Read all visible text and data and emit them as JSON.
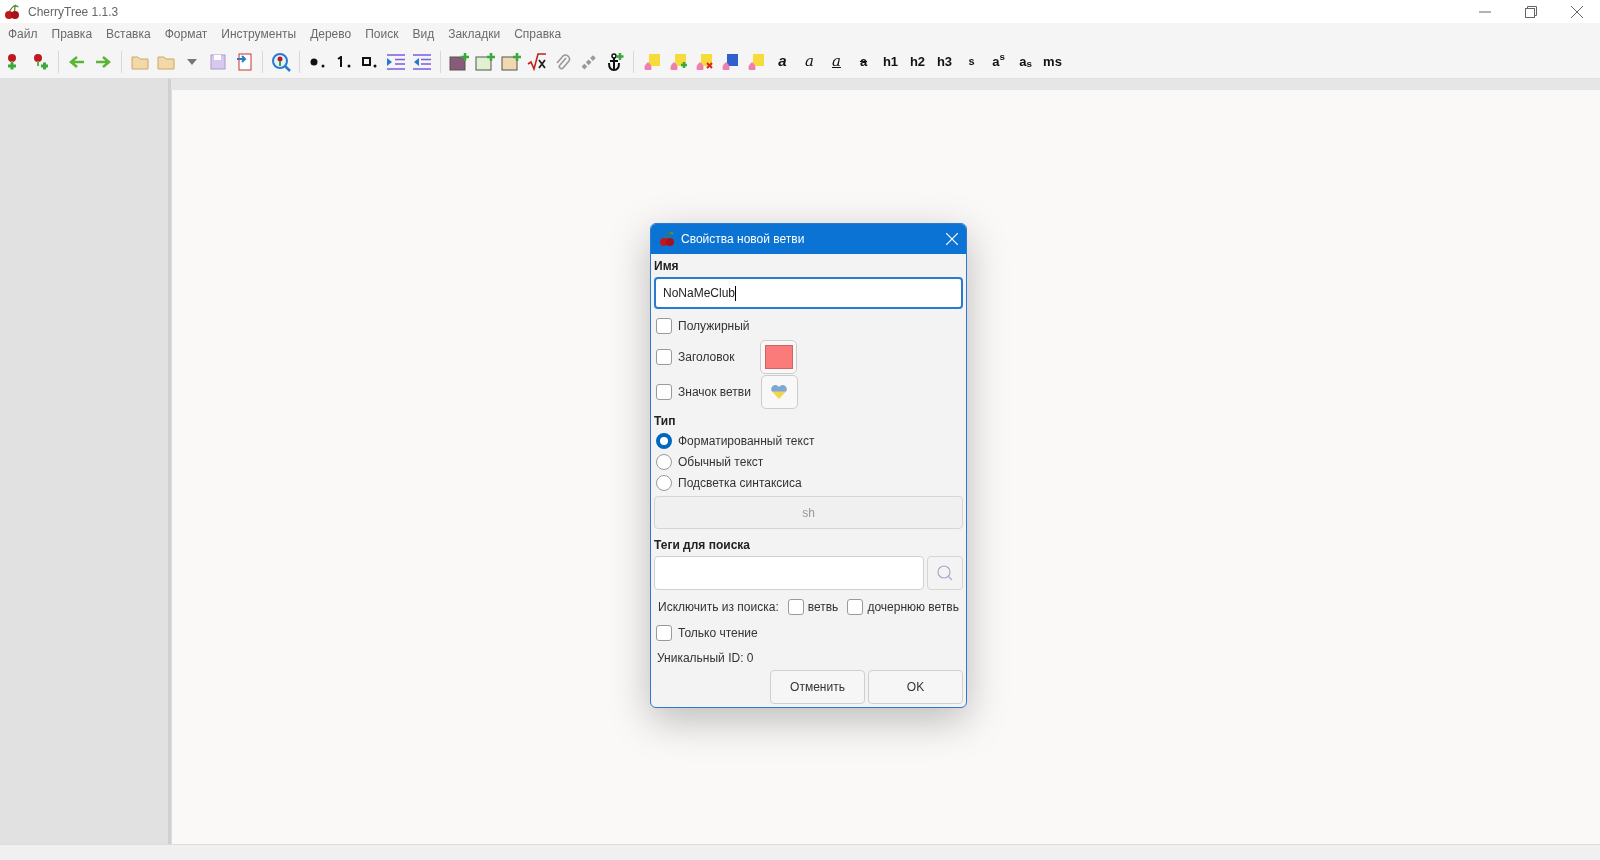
{
  "window": {
    "title": "CherryTree 1.1.3"
  },
  "menu": [
    "Файл",
    "Правка",
    "Вставка",
    "Формат",
    "Инструменты",
    "Дерево",
    "Поиск",
    "Вид",
    "Закладки",
    "Справка"
  ],
  "format_buttons": [
    {
      "kind": "bold",
      "label": "a"
    },
    {
      "kind": "italic",
      "label": "a"
    },
    {
      "kind": "underline",
      "label": "a"
    },
    {
      "kind": "strike",
      "label": "a"
    },
    {
      "kind": "plain",
      "label": "h1"
    },
    {
      "kind": "plain",
      "label": "h2"
    },
    {
      "kind": "plain",
      "label": "h3"
    },
    {
      "kind": "small",
      "label": "s"
    },
    {
      "kind": "plain",
      "label": "a$^{s}$"
    },
    {
      "kind": "plain",
      "label": "a$_{s}$"
    },
    {
      "kind": "plain",
      "label": "ms"
    }
  ],
  "dialog": {
    "title": "Свойства новой ветви",
    "name_label": "Имя",
    "name_value": "NoNaMeClub",
    "options": [
      {
        "kind": "plain",
        "label": "Полужирный",
        "checked": false
      },
      {
        "kind": "color",
        "label": "Заголовок",
        "checked": false,
        "color": "#fb7b7b"
      },
      {
        "kind": "icon",
        "label": "Значок ветви",
        "checked": false
      }
    ],
    "type_label": "Тип",
    "types": [
      {
        "label": "Форматированный текст",
        "selected": true
      },
      {
        "label": "Обычный текст",
        "selected": false
      },
      {
        "label": "Подсветка синтаксиса",
        "selected": false
      }
    ],
    "syntax_value": "sh",
    "tags_label": "Теги для поиска",
    "exclude_label": "Исключить из поиска:",
    "exclude": [
      {
        "label": "ветвь",
        "checked": false
      },
      {
        "label": "дочернюю ветвь",
        "checked": false
      }
    ],
    "readonly": {
      "label": "Только чтение",
      "checked": false
    },
    "unique_id": "Уникальный ID: 0",
    "buttons": [
      "Отменить",
      "OK"
    ]
  }
}
